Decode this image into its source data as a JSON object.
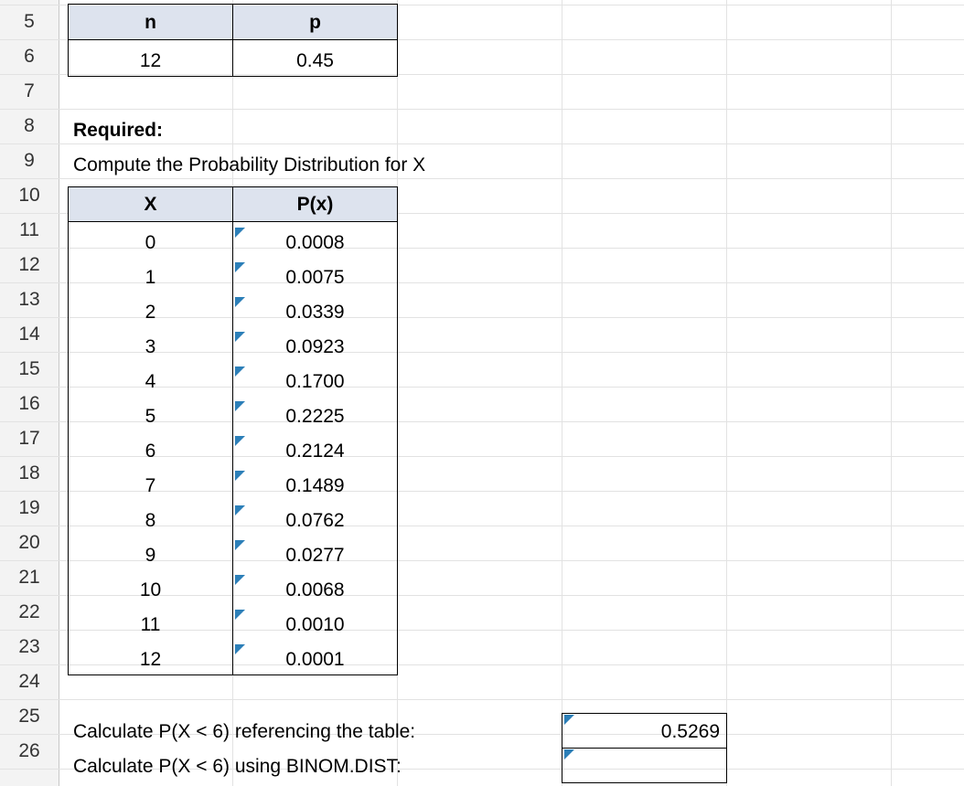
{
  "row_numbers": [
    "5",
    "6",
    "7",
    "8",
    "9",
    "10",
    "11",
    "12",
    "13",
    "14",
    "15",
    "16",
    "17",
    "18",
    "19",
    "20",
    "21",
    "22",
    "23",
    "24",
    "25",
    "26"
  ],
  "params": {
    "n_header": "n",
    "p_header": "p",
    "n_value": "12",
    "p_value": "0.45"
  },
  "required_label": "Required:",
  "instruction": "Compute the Probability Distribution for X",
  "table": {
    "x_header": "X",
    "px_header": "P(x)",
    "rows": [
      {
        "x": "0",
        "px": "0.0008"
      },
      {
        "x": "1",
        "px": "0.0075"
      },
      {
        "x": "2",
        "px": "0.0339"
      },
      {
        "x": "3",
        "px": "0.0923"
      },
      {
        "x": "4",
        "px": "0.1700"
      },
      {
        "x": "5",
        "px": "0.2225"
      },
      {
        "x": "6",
        "px": "0.2124"
      },
      {
        "x": "7",
        "px": "0.1489"
      },
      {
        "x": "8",
        "px": "0.0762"
      },
      {
        "x": "9",
        "px": "0.0277"
      },
      {
        "x": "10",
        "px": "0.0068"
      },
      {
        "x": "11",
        "px": "0.0010"
      },
      {
        "x": "12",
        "px": "0.0001"
      }
    ]
  },
  "calc1": {
    "label": "Calculate P(X < 6) referencing the table:",
    "value": "0.5269"
  },
  "calc2": {
    "label": "Calculate P(X < 6) using BINOM.DIST:",
    "value": ""
  },
  "colors": {
    "header_fill": "#dde3ee",
    "comment_marker": "#2c7fb8",
    "gridline": "#e2e2e2"
  }
}
